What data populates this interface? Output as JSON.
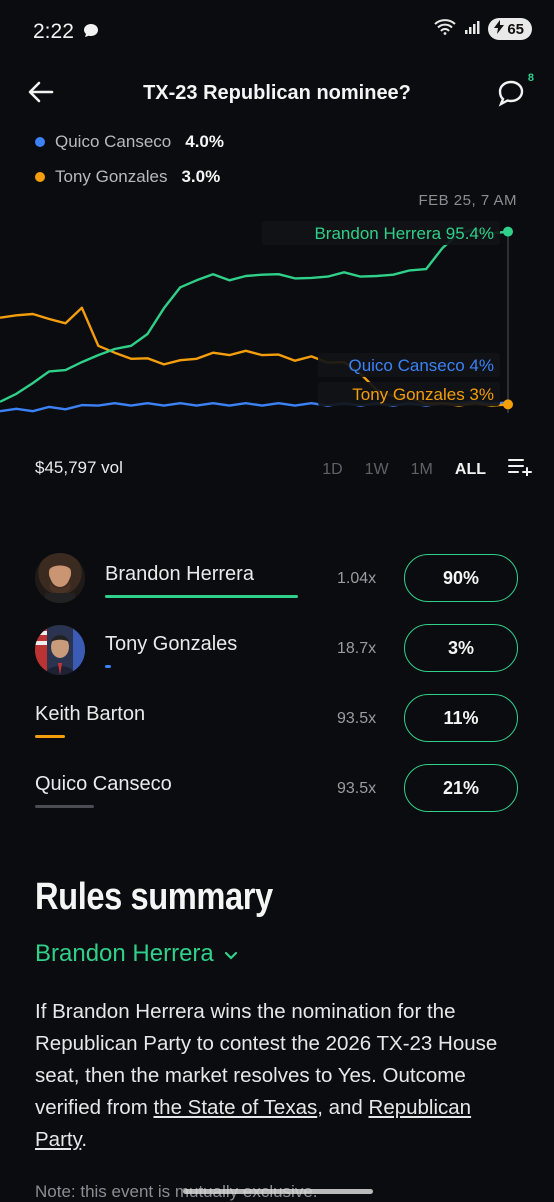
{
  "status": {
    "time": "2:22",
    "battery": "65"
  },
  "header": {
    "title": "TX-23 Republican nominee?",
    "comment_count": "8"
  },
  "legend": [
    {
      "name": "Quico Canseco",
      "pct": "4.0%",
      "color": "#3b82f6"
    },
    {
      "name": "Tony Gonzales",
      "pct": "3.0%",
      "color": "#f59e0b"
    }
  ],
  "chart": {
    "timestamp": "FEB 25, 7 AM",
    "labels": {
      "herrera": "Brandon Herrera 95.4%",
      "canseco": "Quico Canseco 4%",
      "gonzales": "Tony Gonzales 3%"
    },
    "colors": {
      "herrera": "#2fd08a",
      "canseco": "#3b82f6",
      "gonzales": "#f59e0b"
    }
  },
  "chart_data": {
    "type": "line",
    "series": [
      {
        "name": "Brandon Herrera",
        "values": [
          5,
          8,
          15,
          20,
          22,
          25,
          30,
          32,
          35,
          40,
          55,
          65,
          70,
          72,
          70,
          71,
          73,
          72,
          71,
          70,
          72,
          73,
          72,
          71,
          73,
          74,
          76,
          86,
          95,
          96,
          95,
          95.4
        ]
      },
      {
        "name": "Tony Gonzales",
        "values": [
          50,
          50,
          52,
          48,
          47,
          54,
          35,
          30,
          28,
          27,
          25,
          26,
          28,
          30,
          30,
          31,
          30,
          29,
          27,
          28,
          26,
          25,
          20,
          10,
          8,
          6,
          4,
          3,
          3,
          3,
          3,
          3
        ]
      },
      {
        "name": "Quico Canseco",
        "values": [
          0,
          0,
          0,
          1,
          1,
          2,
          3,
          3,
          3,
          3,
          3,
          3,
          3,
          3,
          3,
          3,
          3,
          3,
          3,
          3,
          3,
          3,
          3,
          3,
          3,
          3,
          3,
          3,
          4,
          4,
          4,
          4
        ]
      }
    ],
    "ylim": [
      0,
      100
    ]
  },
  "controls": {
    "volume": "$45,797 vol",
    "ranges": [
      "1D",
      "1W",
      "1M",
      "ALL"
    ],
    "active_range": "ALL"
  },
  "outcomes": [
    {
      "name": "Brandon Herrera",
      "multiplier": "1.04x",
      "pct": "90%",
      "line_color": "#2fd08a",
      "line_fraction": 0.95,
      "has_avatar": true
    },
    {
      "name": "Tony Gonzales",
      "multiplier": "18.7x",
      "pct": "3%",
      "line_color": "#3b82f6",
      "line_fraction": 0.03,
      "has_avatar": true
    },
    {
      "name": "Keith Barton",
      "multiplier": "93.5x",
      "pct": "11%",
      "line_color": "#f59e0b",
      "line_fraction": 0.1,
      "has_avatar": false
    },
    {
      "name": "Quico Canseco",
      "multiplier": "93.5x",
      "pct": "21%",
      "line_color": "#4b4d52",
      "line_fraction": 0.2,
      "has_avatar": false
    }
  ],
  "rules": {
    "title": "Rules summary",
    "selected_outcome": "Brandon Herrera",
    "body_part1": "If Brandon Herrera wins the nomination for the Republican Party to contest the 2026 TX-23 House seat, then the market resolves to Yes. Outcome verified from ",
    "link1": "the State of Texas",
    "body_part2": ", and ",
    "link2": "Republican Party",
    "body_part3": ".",
    "note": "Note: this event is mutually exclusive."
  }
}
